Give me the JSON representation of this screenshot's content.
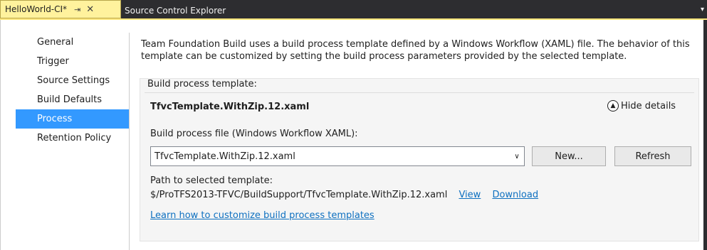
{
  "tabs": {
    "active": {
      "title": "HelloWorld-CI*",
      "pin_icon": "pin-icon",
      "close_icon": "close-icon"
    },
    "inactive": {
      "title": "Source Control Explorer"
    },
    "overflow_icon": "chevron-down-icon"
  },
  "nav": {
    "items": [
      {
        "label": "General"
      },
      {
        "label": "Trigger"
      },
      {
        "label": "Source Settings"
      },
      {
        "label": "Build Defaults"
      },
      {
        "label": "Process",
        "selected": true
      },
      {
        "label": "Retention Policy"
      }
    ]
  },
  "main": {
    "description": "Team Foundation Build uses a build process template defined by a Windows Workflow (XAML) file. The behavior of this template can be customized by setting the build process parameters provided by the selected template.",
    "panel": {
      "label": "Build process template:",
      "template_name": "TfvcTemplate.WithZip.12.xaml",
      "hide_details": "Hide details",
      "file_label": "Build process file (Windows Workflow XAML):",
      "file_value": "TfvcTemplate.WithZip.12.xaml",
      "new_button": "New...",
      "refresh_button": "Refresh",
      "path_label": "Path to selected template:",
      "path_value": "$/ProTFS2013-TFVC/BuildSupport/TfvcTemplate.WithZip.12.xaml",
      "view_link": "View",
      "download_link": "Download",
      "learn_link": "Learn how to customize build process templates"
    }
  },
  "colors": {
    "tab_active_bg": "#fff29d",
    "tabstrip_bg": "#2d2d30",
    "selected_nav_bg": "#3399ff",
    "link": "#0e70c0"
  }
}
